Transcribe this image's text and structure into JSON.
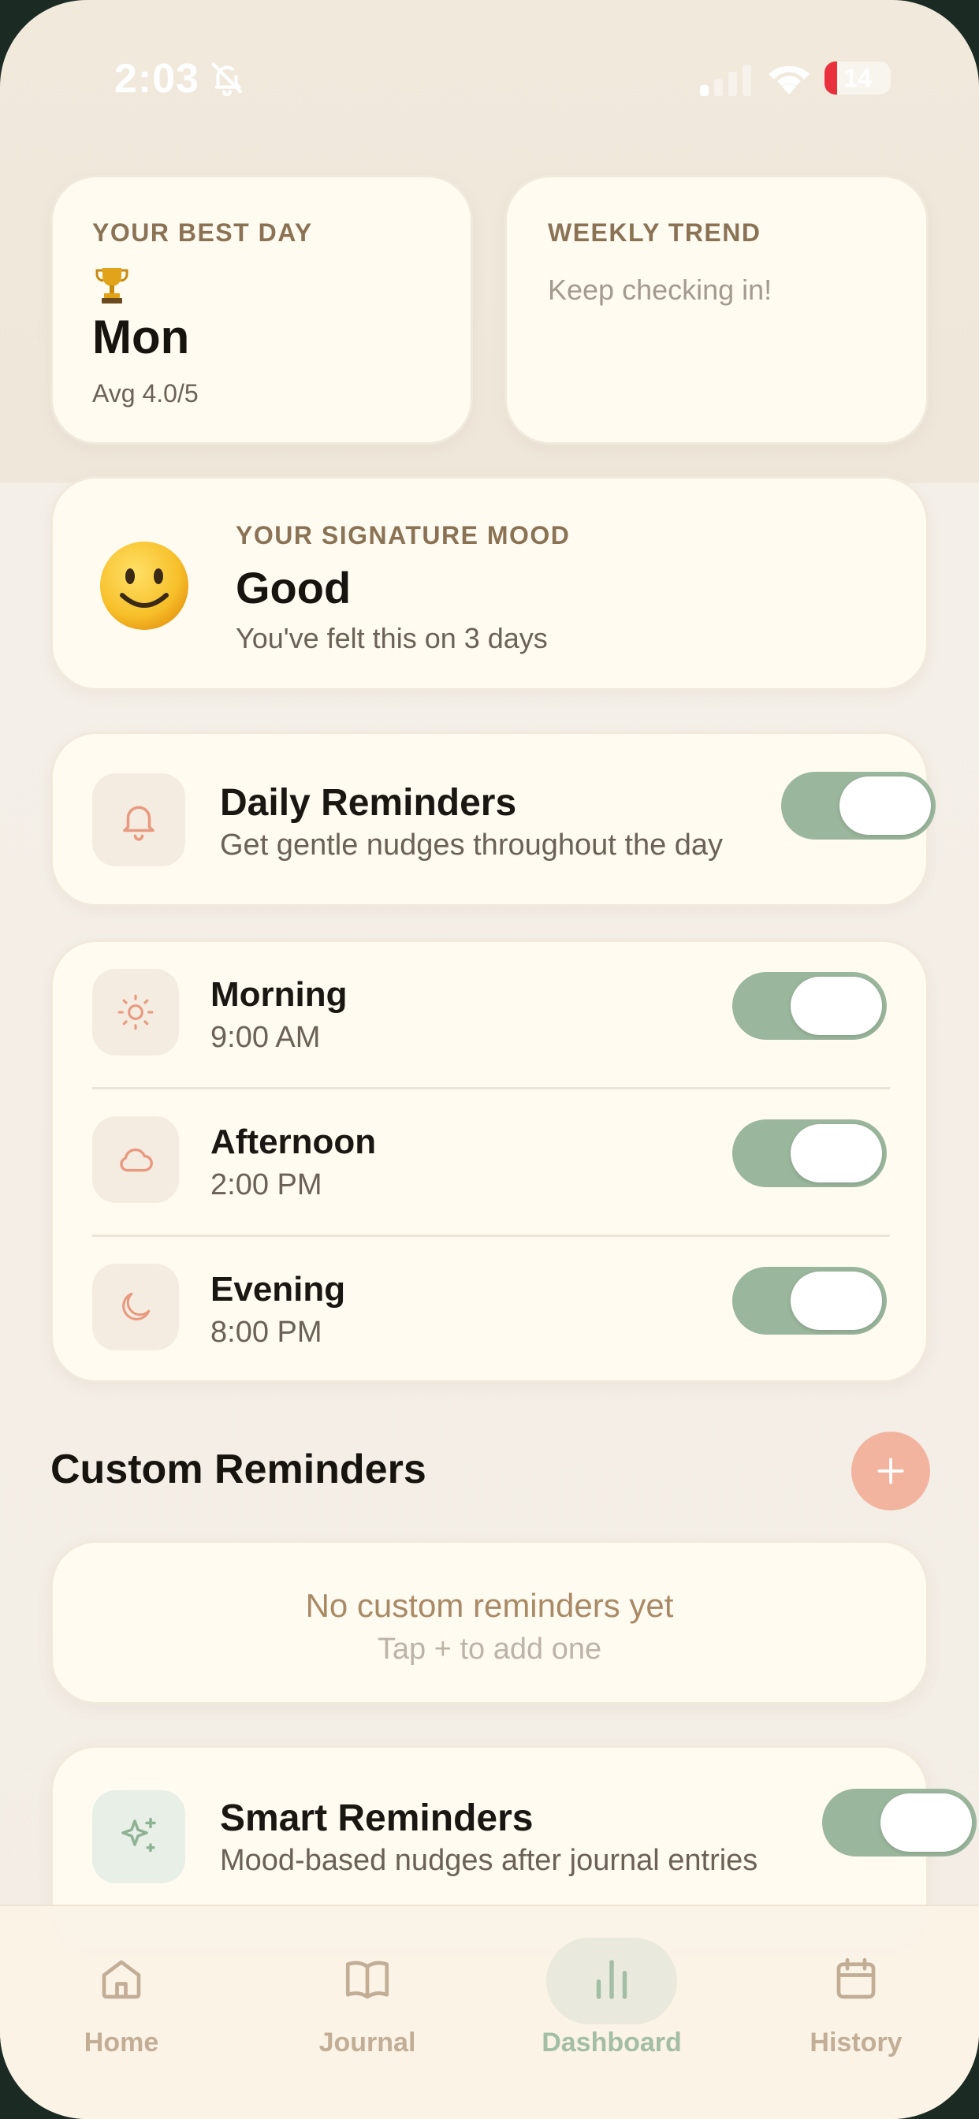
{
  "status_bar": {
    "time": "2:03",
    "battery": "14"
  },
  "best_day": {
    "label": "YOUR BEST DAY",
    "value": "Mon",
    "sub": "Avg 4.0/5"
  },
  "weekly_trend": {
    "label": "WEEKLY TREND",
    "message": "Keep checking in!"
  },
  "signature_mood": {
    "label": "YOUR SIGNATURE MOOD",
    "value": "Good",
    "sub": "You've felt this on 3 days"
  },
  "daily_reminders": {
    "title": "Daily Reminders",
    "subtitle": "Get gentle nudges throughout the day",
    "enabled": true
  },
  "time_slots": [
    {
      "name": "Morning",
      "time": "9:00 AM",
      "icon": "sun-icon",
      "enabled": true
    },
    {
      "name": "Afternoon",
      "time": "2:00 PM",
      "icon": "cloud-icon",
      "enabled": true
    },
    {
      "name": "Evening",
      "time": "8:00 PM",
      "icon": "moon-icon",
      "enabled": true
    }
  ],
  "custom_reminders": {
    "title": "Custom Reminders",
    "empty_title": "No custom reminders yet",
    "empty_sub": "Tap + to add one"
  },
  "smart_reminders": {
    "title": "Smart Reminders",
    "subtitle": "Mood-based nudges after journal entries",
    "enabled": true
  },
  "tabs": [
    {
      "label": "Home",
      "icon": "home-icon",
      "active": false
    },
    {
      "label": "Journal",
      "icon": "book-icon",
      "active": false
    },
    {
      "label": "Dashboard",
      "icon": "bar-chart-icon",
      "active": true
    },
    {
      "label": "History",
      "icon": "calendar-icon",
      "active": false
    }
  ],
  "colors": {
    "accent_green": "#9ab69c",
    "accent_peach": "#f2b49f",
    "card_bg": "#fffbf1",
    "label_brown": "#8a7355"
  }
}
